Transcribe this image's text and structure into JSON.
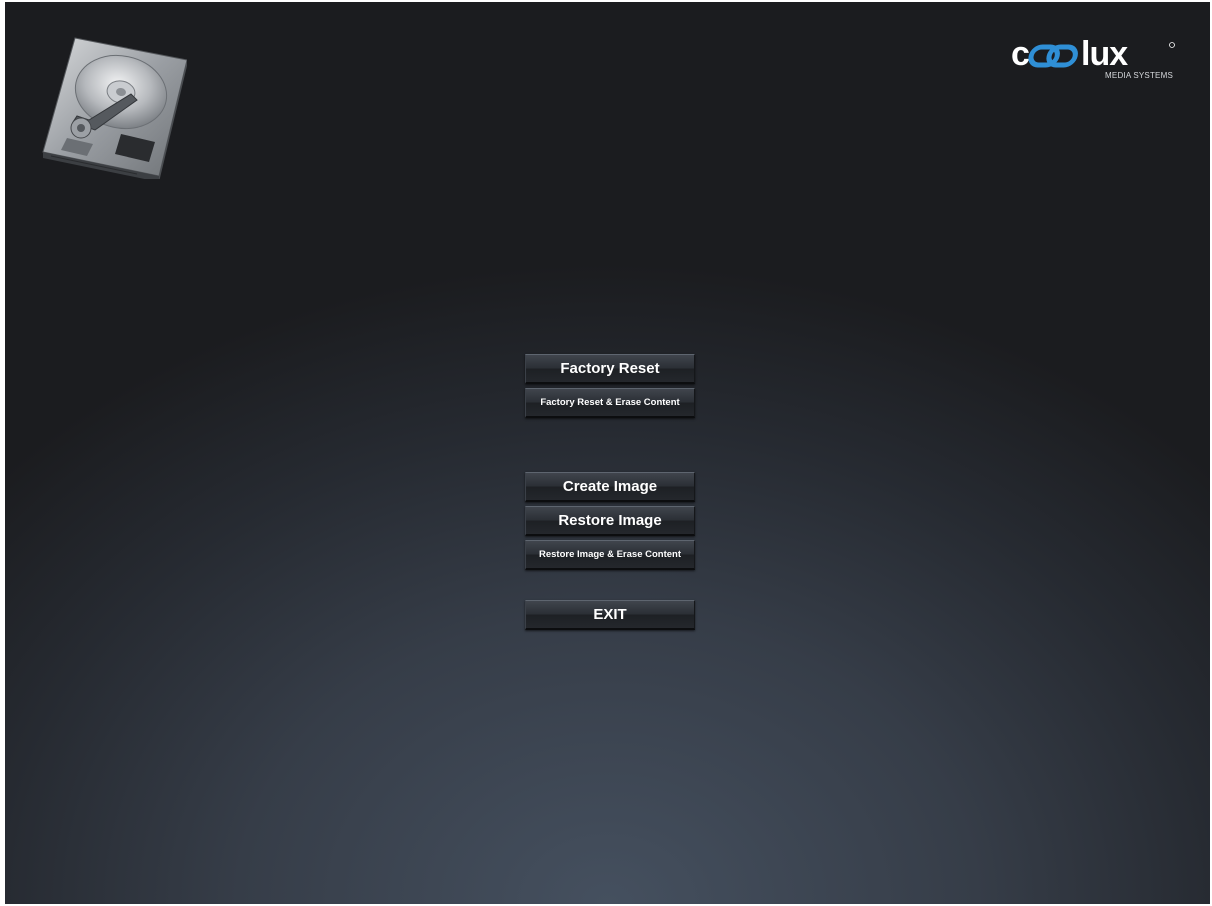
{
  "logo": {
    "brand": "coolux",
    "tagline": "MEDIA SYSTEMS"
  },
  "menu": {
    "factory_reset": "Factory Reset",
    "factory_reset_erase": "Factory Reset & Erase Content",
    "create_image": "Create Image",
    "restore_image": "Restore Image",
    "restore_image_erase": "Restore Image & Erase Content",
    "exit": "EXIT"
  },
  "icons": {
    "hard_drive": "hard-drive-icon"
  },
  "colors": {
    "logo_accent": "#2f8fd6",
    "logo_white": "#ffffff",
    "background_center": "#45505f",
    "background_edge": "#1b1c1f"
  }
}
